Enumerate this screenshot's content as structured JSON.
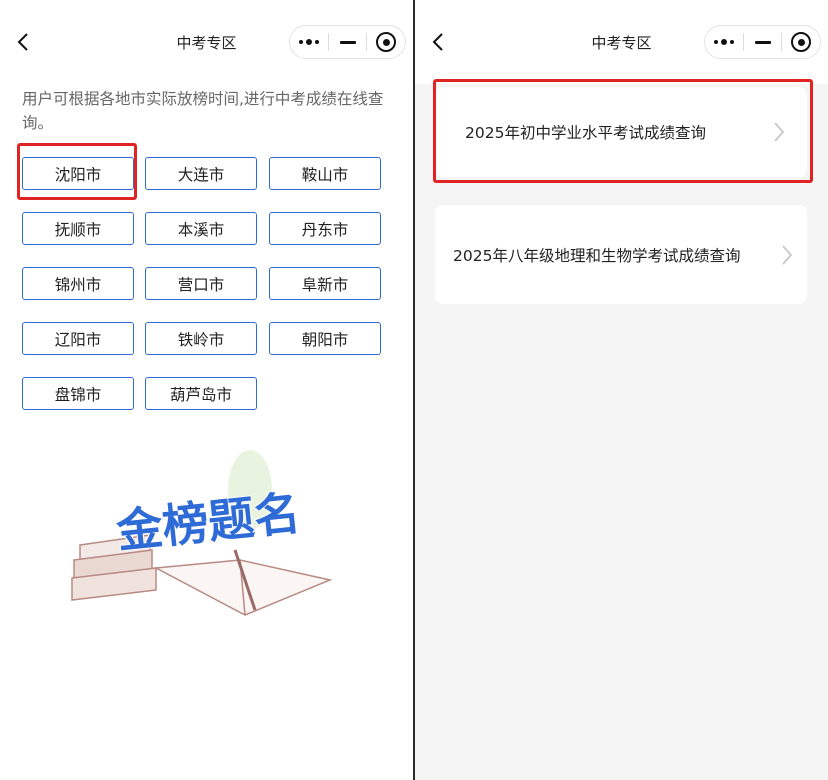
{
  "left_screen": {
    "title": "中考专区",
    "intro_text": "用户可根据各地市实际放榜时间,进行中考成绩在线查询。",
    "cities": [
      "沈阳市",
      "大连市",
      "鞍山市",
      "抚顺市",
      "本溪市",
      "丹东市",
      "锦州市",
      "营口市",
      "阜新市",
      "辽阳市",
      "铁岭市",
      "朝阳市",
      "盘锦市",
      "葫芦岛市"
    ],
    "highlighted_city": "沈阳市",
    "illustration_text": "金榜题名"
  },
  "right_screen": {
    "title": "中考专区",
    "items": [
      {
        "label": "2025年初中学业水平考试成绩查询",
        "highlighted": true
      },
      {
        "label": "2025年八年级地理和生物学考试成绩查询",
        "highlighted": false
      }
    ]
  },
  "colors": {
    "accent": "#2f6bd6",
    "highlight": "#e02424",
    "right_bg": "#f5f5f5"
  },
  "icons": [
    "back-arrow-icon",
    "more-dots-icon",
    "minimize-icon",
    "close-target-icon",
    "chevron-right-icon",
    "book-illustration"
  ]
}
